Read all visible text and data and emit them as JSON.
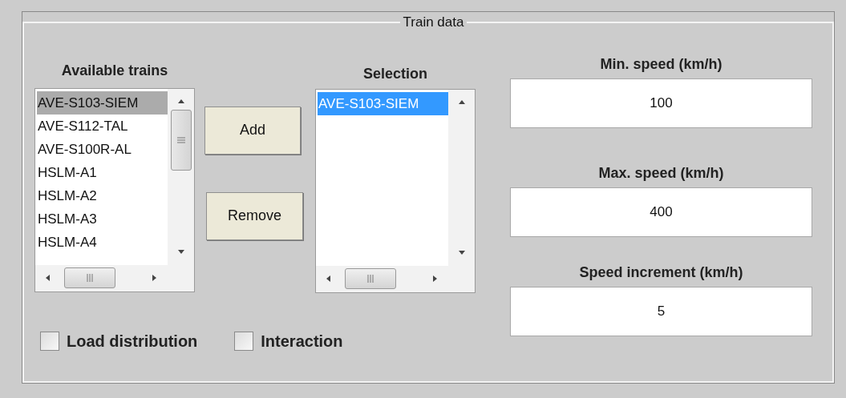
{
  "panel": {
    "title": "Train data"
  },
  "available": {
    "label": "Available trains",
    "items": [
      {
        "text": "AVE-S103-SIEM",
        "selected": true
      },
      {
        "text": "AVE-S112-TAL",
        "selected": false
      },
      {
        "text": "AVE-S100R-AL",
        "selected": false
      },
      {
        "text": "HSLM-A1",
        "selected": false
      },
      {
        "text": "HSLM-A2",
        "selected": false
      },
      {
        "text": "HSLM-A3",
        "selected": false
      },
      {
        "text": "HSLM-A4",
        "selected": false
      }
    ]
  },
  "buttons": [
    {
      "label": "Add"
    },
    {
      "label": "Remove"
    }
  ],
  "selection": {
    "label": "Selection",
    "items": [
      {
        "text": "AVE-S103-SIEM",
        "selected": true
      }
    ]
  },
  "fields": [
    {
      "label": "Min. speed (km/h)",
      "value": "100"
    },
    {
      "label": "Max. speed (km/h)",
      "value": "400"
    },
    {
      "label": "Speed increment (km/h)",
      "value": "5"
    }
  ],
  "checkboxes": [
    {
      "label": "Load distribution",
      "checked": false
    },
    {
      "label": "Interaction",
      "checked": false
    }
  ]
}
